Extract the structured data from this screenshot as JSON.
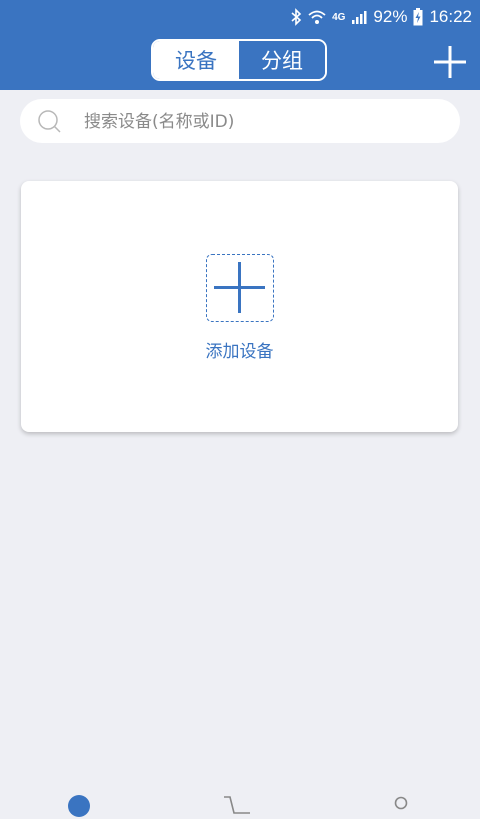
{
  "status_bar": {
    "network": "4G",
    "battery": "92%",
    "time": "16:22",
    "icons": [
      "bluetooth-icon",
      "wifi-icon",
      "signal-icon",
      "battery-charging-icon"
    ]
  },
  "header": {
    "tabs": [
      {
        "label": "设备",
        "active": true
      },
      {
        "label": "分组",
        "active": false
      }
    ],
    "add_icon": "plus-icon"
  },
  "search": {
    "placeholder": "搜索设备(名称或ID)",
    "value": "",
    "icon": "search-icon"
  },
  "main": {
    "add_device_label": "添加设备",
    "add_device_icon": "plus-icon"
  },
  "bottom_nav": {
    "icons": [
      "home-icon",
      "cart-icon",
      "user-icon"
    ]
  },
  "colors": {
    "primary": "#3a74c1",
    "background": "#eeeff4",
    "card": "#ffffff"
  }
}
